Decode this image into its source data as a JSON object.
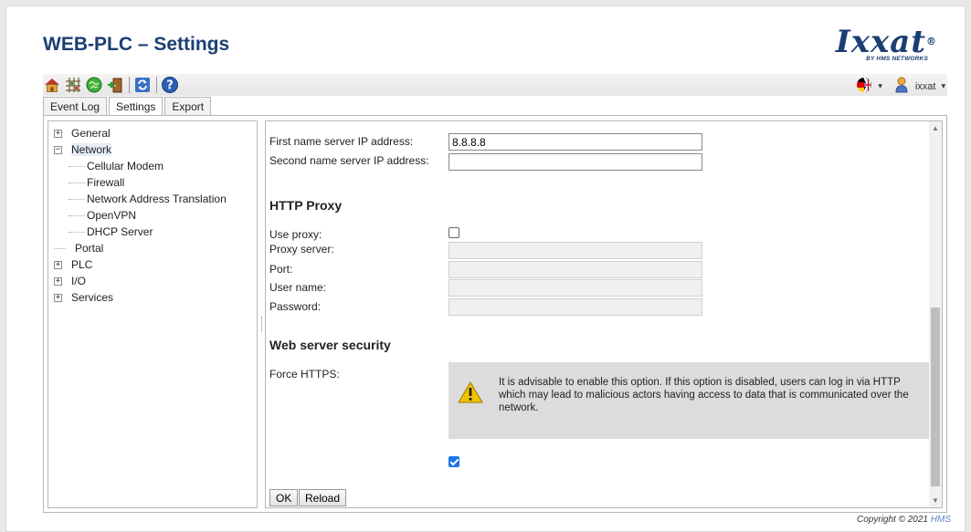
{
  "header": {
    "title": "WEB-PLC – Settings",
    "logo_text": "Ixxat",
    "logo_reg": "®",
    "logo_sub": "BY HMS NETWORKS"
  },
  "toolbar": {
    "icons": [
      "home-icon",
      "grid-icon",
      "globe-icon",
      "door-exit-icon",
      "refresh-icon",
      "help-icon"
    ],
    "language_icon": "flag-icon",
    "user_label": "ixxat",
    "caret": "▾"
  },
  "tabs": [
    {
      "label": "Event Log",
      "active": false
    },
    {
      "label": "Settings",
      "active": true
    },
    {
      "label": "Export",
      "active": false
    }
  ],
  "tree": {
    "general": "General",
    "network": "Network",
    "network_children": [
      "Cellular Modem",
      "Firewall",
      "Network Address Translation",
      "OpenVPN",
      "DHCP Server"
    ],
    "portal": "Portal",
    "plc": "PLC",
    "io": "I/O",
    "services": "Services",
    "plus": "+",
    "minus": "−"
  },
  "form": {
    "dns1_label": "First name server IP address:",
    "dns1_value": "8.8.8.8",
    "dns2_label": "Second name server IP address:",
    "dns2_value": "",
    "proxy_heading": "HTTP Proxy",
    "use_proxy_label": "Use proxy:",
    "use_proxy_checked": false,
    "proxy_server_label": "Proxy server:",
    "port_label": "Port:",
    "username_label": "User name:",
    "password_label": "Password:",
    "security_heading": "Web server security",
    "force_https_label": "Force HTTPS:",
    "warning_text": "It is advisable to enable this option. If this option is disabled, users can log in via HTTP which may lead to malicious actors having access to data that is communicated over the network.",
    "force_https_checked": true
  },
  "buttons": {
    "ok": "OK",
    "reload": "Reload"
  },
  "footer": {
    "copyright": "Copyright © 2021",
    "company": "HMS"
  },
  "colors": {
    "title": "#1b3f73",
    "accent": "#1a73e8",
    "warning": "#f2c200"
  }
}
